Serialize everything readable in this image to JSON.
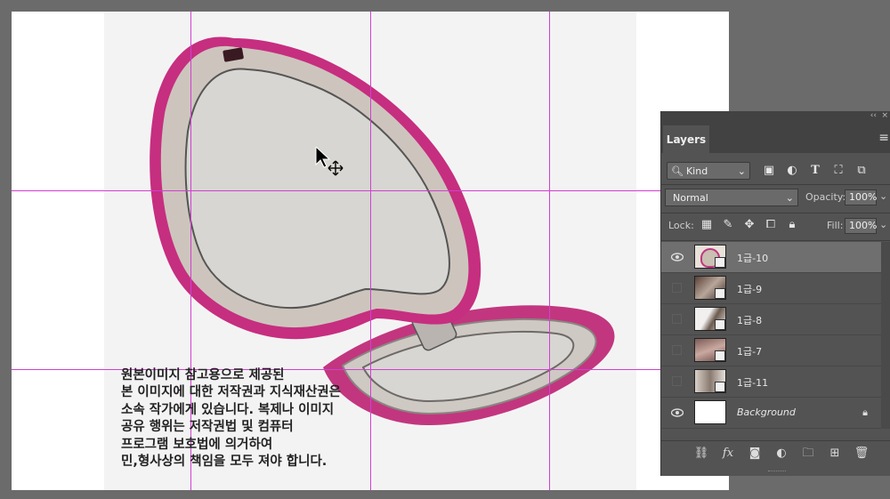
{
  "watermark_lines": [
    "원본이미지 참고용으로 제공된",
    "본 이미지에 대한 저작권과 지식재산권은",
    "소속 작가에게 있습니다. 복제나 이미지",
    "공유 행위는 저작권법 및 컴퓨터",
    "프로그램 보호법에 의거하여",
    "민,형사상의 책임을 모두 져야 합니다."
  ],
  "panel": {
    "collapse_icon": "‹‹",
    "close_icon": "×",
    "tab_label": "Layers",
    "filter_label": "Kind",
    "blend_mode": "Normal",
    "opacity_label": "Opacity:",
    "opacity_value": "100%",
    "lock_label": "Lock:",
    "fill_label": "Fill:",
    "fill_value": "100%"
  },
  "layers": [
    {
      "name": "1급-10",
      "visible": true,
      "selected": true
    },
    {
      "name": "1급-9",
      "visible": false,
      "selected": false
    },
    {
      "name": "1급-8",
      "visible": false,
      "selected": false
    },
    {
      "name": "1급-7",
      "visible": false,
      "selected": false
    },
    {
      "name": "1급-11",
      "visible": false,
      "selected": false
    },
    {
      "name": "Background",
      "visible": true,
      "selected": false,
      "locked": true
    }
  ],
  "colors": {
    "guide": "#d040d0",
    "mirror_rim": "#c8307a",
    "panel_bg": "#535353"
  }
}
